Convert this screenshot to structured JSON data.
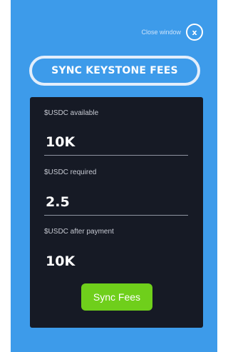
{
  "header": {
    "close_label": "Close window",
    "close_glyph": "x"
  },
  "title": "SYNC KEYSTONE FEES",
  "fields": {
    "available": {
      "label": "$USDC available",
      "value": "10K"
    },
    "required": {
      "label": "$USDC required",
      "value": "2.5"
    },
    "after_payment": {
      "label": "$USDC after payment",
      "value": "10K"
    }
  },
  "sync_button_label": "Sync Fees",
  "colors": {
    "panel_bg": "#3d9bea",
    "card_bg": "#161a25",
    "accent_green": "#6fcf1b"
  },
  "icons": {
    "close": "close-icon"
  }
}
